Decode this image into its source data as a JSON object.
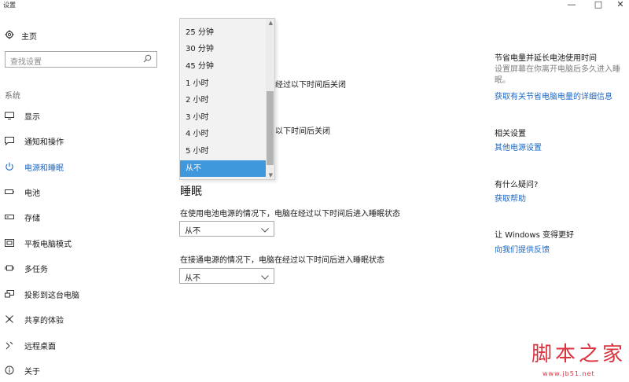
{
  "window": {
    "title": "设置",
    "minimize": "—",
    "maximize": "□",
    "close": "✕"
  },
  "sidebar": {
    "home": {
      "label": "主页",
      "icon": "gear-icon"
    },
    "search": {
      "placeholder": "查找设置",
      "icon": "search-icon"
    },
    "section": "系统",
    "items": [
      {
        "label": "显示",
        "icon": "display-icon"
      },
      {
        "label": "通知和操作",
        "icon": "notification-icon"
      },
      {
        "label": "电源和睡眠",
        "icon": "power-icon",
        "active": true
      },
      {
        "label": "电池",
        "icon": "battery-icon"
      },
      {
        "label": "存储",
        "icon": "storage-icon"
      },
      {
        "label": "平板电脑模式",
        "icon": "tablet-mode-icon"
      },
      {
        "label": "多任务",
        "icon": "multitasking-icon"
      },
      {
        "label": "投影到这台电脑",
        "icon": "project-icon"
      },
      {
        "label": "共享的体验",
        "icon": "shared-experience-icon"
      },
      {
        "label": "远程桌面",
        "icon": "remote-desktop-icon"
      },
      {
        "label": "关于",
        "icon": "about-icon"
      }
    ]
  },
  "main": {
    "screen_battery_text_partial": "经过以下时间后关闭",
    "screen_plugged_text_partial": "以下时间后关闭",
    "sleep_heading": "睡眠",
    "sleep_battery_label": "在使用电池电源的情况下，电脑在经过以下时间后进入睡眠状态",
    "sleep_battery_value": "从不",
    "sleep_plugged_label": "在接通电源的情况下，电脑在经过以下时间后进入睡眠状态",
    "sleep_plugged_value": "从不",
    "dropdown": {
      "options": [
        "25 分钟",
        "30 分钟",
        "45 分钟",
        "1 小时",
        "2 小时",
        "3 小时",
        "4 小时",
        "5 小时",
        "从不"
      ],
      "selected": "从不"
    }
  },
  "right": {
    "save_heading": "节省电量并延长电池使用时间",
    "save_desc": "设置屏幕在你离开电脑后多久进入睡眠。",
    "save_link": "获取有关节省电脑电量的详细信息",
    "related_heading": "相关设置",
    "related_link": "其他电源设置",
    "question_heading": "有什么疑问?",
    "question_link": "获取帮助",
    "better_heading": "让 Windows 变得更好",
    "better_link": "向我们提供反馈"
  },
  "watermark": {
    "text": "脚本之家",
    "url": "www.jb51.net"
  },
  "colors": {
    "accent": "#1a68c7",
    "selection": "#3f97dc",
    "watermark": "#d9333d"
  }
}
